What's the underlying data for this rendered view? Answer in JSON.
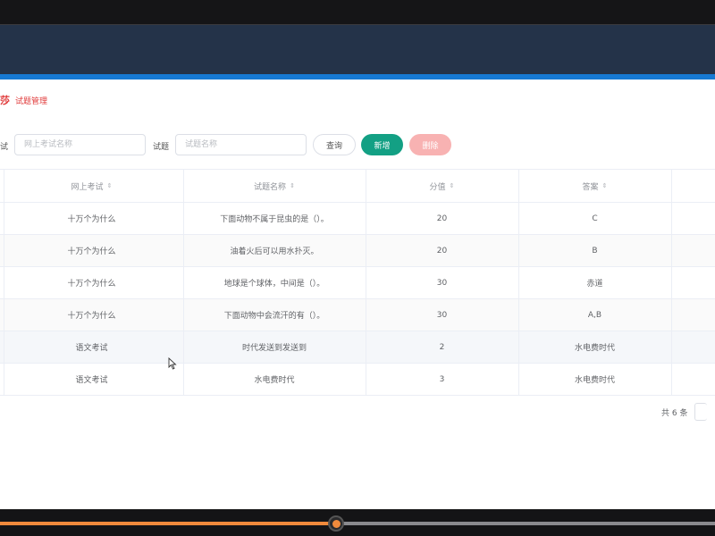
{
  "breadcrumb": {
    "home": "莎",
    "current": "试题管理"
  },
  "search": {
    "exam_label": "试",
    "exam_placeholder": "网上考试名称",
    "question_label": "试题",
    "question_placeholder": "试题名称",
    "query_button": "查询",
    "add_button": "新增",
    "delete_button": "删除"
  },
  "table": {
    "columns": [
      "网上考试",
      "试题名称",
      "分值",
      "答案"
    ],
    "sort_glyph": "⇕",
    "rows": [
      {
        "exam": "十万个为什么",
        "question": "下面动物不属于昆虫的是（）。",
        "score": "20",
        "answer": "C"
      },
      {
        "exam": "十万个为什么",
        "question": "油着火后可以用水扑灭。",
        "score": "20",
        "answer": "B"
      },
      {
        "exam": "十万个为什么",
        "question": "地球是个球体，中间是（）。",
        "score": "30",
        "answer": "赤道"
      },
      {
        "exam": "十万个为什么",
        "question": "下面动物中会流汗的有（）。",
        "score": "30",
        "answer": "A,B"
      },
      {
        "exam": "语文考试",
        "question": "时代发送到发送到",
        "score": "2",
        "answer": "水电费时代"
      },
      {
        "exam": "语文考试",
        "question": "水电费时代",
        "score": "3",
        "answer": "水电费时代"
      }
    ]
  },
  "pagination": {
    "total": "共 6 条"
  },
  "colors": {
    "header_bg": "#243349",
    "accent_blue": "#1679d3",
    "add_green": "#13a084",
    "delete_pink": "#f8b2b2",
    "breadcrumb_red": "#e03a3a",
    "progress_orange": "#f08a3c"
  },
  "video_player": {
    "progress": 0.47
  }
}
